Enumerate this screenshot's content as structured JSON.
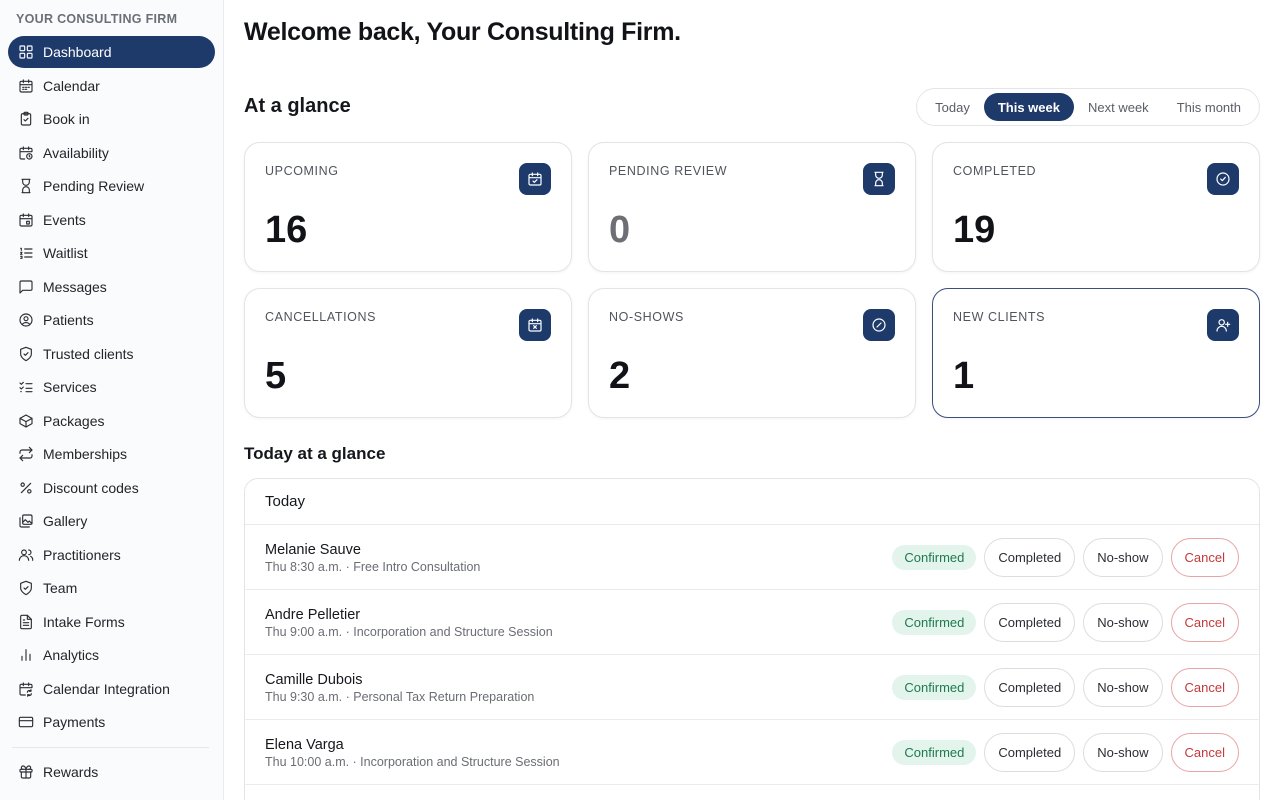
{
  "brand": "YOUR CONSULTING FIRM",
  "colors": {
    "accent": "#1e3a6b",
    "confirmed_bg": "#e2f4ec",
    "confirmed_text": "#1f7a4e",
    "cancel": "#c23a3a"
  },
  "sidebar": {
    "items": [
      {
        "label": "Dashboard",
        "icon": "grid-icon",
        "active": true
      },
      {
        "label": "Calendar",
        "icon": "calendar-icon"
      },
      {
        "label": "Book in",
        "icon": "clipboard-icon"
      },
      {
        "label": "Availability",
        "icon": "calendar-clock-icon"
      },
      {
        "label": "Pending Review",
        "icon": "hourglass-icon"
      },
      {
        "label": "Events",
        "icon": "calendar-event-icon"
      },
      {
        "label": "Waitlist",
        "icon": "list-ordered-icon"
      },
      {
        "label": "Messages",
        "icon": "message-icon"
      },
      {
        "label": "Patients",
        "icon": "user-circle-icon"
      },
      {
        "label": "Trusted clients",
        "icon": "shield-check-icon"
      },
      {
        "label": "Services",
        "icon": "list-check-icon"
      },
      {
        "label": "Packages",
        "icon": "package-icon"
      },
      {
        "label": "Memberships",
        "icon": "repeat-icon"
      },
      {
        "label": "Discount codes",
        "icon": "percent-icon"
      },
      {
        "label": "Gallery",
        "icon": "images-icon"
      },
      {
        "label": "Practitioners",
        "icon": "users-icon"
      },
      {
        "label": "Team",
        "icon": "shield-icon"
      },
      {
        "label": "Intake Forms",
        "icon": "file-text-icon"
      },
      {
        "label": "Analytics",
        "icon": "bar-chart-icon"
      },
      {
        "label": "Calendar Integration",
        "icon": "calendar-sync-icon"
      },
      {
        "label": "Payments",
        "icon": "credit-card-icon"
      }
    ],
    "secondary": [
      {
        "label": "Rewards",
        "icon": "gift-icon"
      }
    ]
  },
  "header": {
    "welcome": "Welcome back, Your Consulting Firm."
  },
  "glance": {
    "title": "At a glance",
    "ranges": [
      "Today",
      "This week",
      "Next week",
      "This month"
    ],
    "active_range": "This week",
    "cards": [
      {
        "label": "UPCOMING",
        "value": "16",
        "icon": "calendar-check-icon"
      },
      {
        "label": "PENDING REVIEW",
        "value": "0",
        "icon": "hourglass-icon"
      },
      {
        "label": "COMPLETED",
        "value": "19",
        "icon": "check-circle-icon"
      },
      {
        "label": "CANCELLATIONS",
        "value": "5",
        "icon": "calendar-x-icon"
      },
      {
        "label": "NO-SHOWS",
        "value": "2",
        "icon": "ban-icon"
      },
      {
        "label": "NEW CLIENTS",
        "value": "1",
        "icon": "user-plus-icon"
      }
    ]
  },
  "today": {
    "title": "Today at a glance",
    "panel_header": "Today",
    "status_label": "Confirmed",
    "completed_label": "Completed",
    "noshow_label": "No-show",
    "cancel_label": "Cancel",
    "appointments": [
      {
        "name": "Melanie Sauve",
        "meta": "Thu 8:30 a.m. · Free Intro Consultation"
      },
      {
        "name": "Andre Pelletier",
        "meta": "Thu 9:00 a.m. · Incorporation and Structure Session"
      },
      {
        "name": "Camille Dubois",
        "meta": "Thu 9:30 a.m. · Personal Tax Return Preparation"
      },
      {
        "name": "Elena Varga",
        "meta": "Thu 10:00 a.m. · Incorporation and Structure Session"
      }
    ]
  }
}
